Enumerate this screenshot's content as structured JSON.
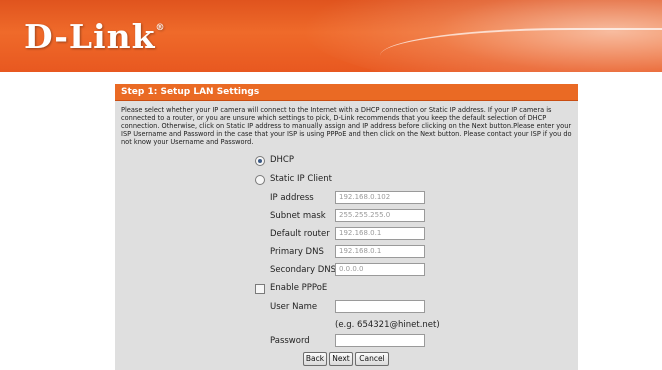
{
  "brand": {
    "logo_text": "D-Link",
    "logo_mark": "®",
    "banner_color": "#e8601f"
  },
  "panel": {
    "title": "Step 1: Setup LAN Settings",
    "accent": "#ea6a24",
    "description": "Please select whether your IP camera will connect to the Internet with a DHCP connection or Static IP address. If your IP camera is connected to a router, or you are unsure which settings to pick, D-Link recommends that you keep the default selection of DHCP connection. Otherwise, click on Static IP address to manually assign and IP address before clicking on the Next button.Please enter your ISP Username and Password in the case that your ISP is using PPPoE and then click on the Next button. Please contact your ISP if you do not know your Username and Password."
  },
  "connection": {
    "selected": "DHCP",
    "dhcp_label": "DHCP",
    "static_label": "Static IP Client"
  },
  "static_ip": {
    "ip_label": "IP address",
    "ip_value": "192.168.0.102",
    "mask_label": "Subnet mask",
    "mask_value": "255.255.255.0",
    "router_label": "Default router",
    "router_value": "192.168.0.1",
    "dns1_label": "Primary DNS",
    "dns1_value": "192.168.0.1",
    "dns2_label": "Secondary DNS",
    "dns2_value": "0.0.0.0"
  },
  "pppoe": {
    "enable_label": "Enable PPPoE",
    "enabled": false,
    "user_label": "User Name",
    "user_value": "",
    "user_hint": "(e.g. 654321@hinet.net)",
    "pass_label": "Password",
    "pass_value": ""
  },
  "buttons": {
    "back": "Back",
    "next": "Next",
    "cancel": "Cancel"
  }
}
